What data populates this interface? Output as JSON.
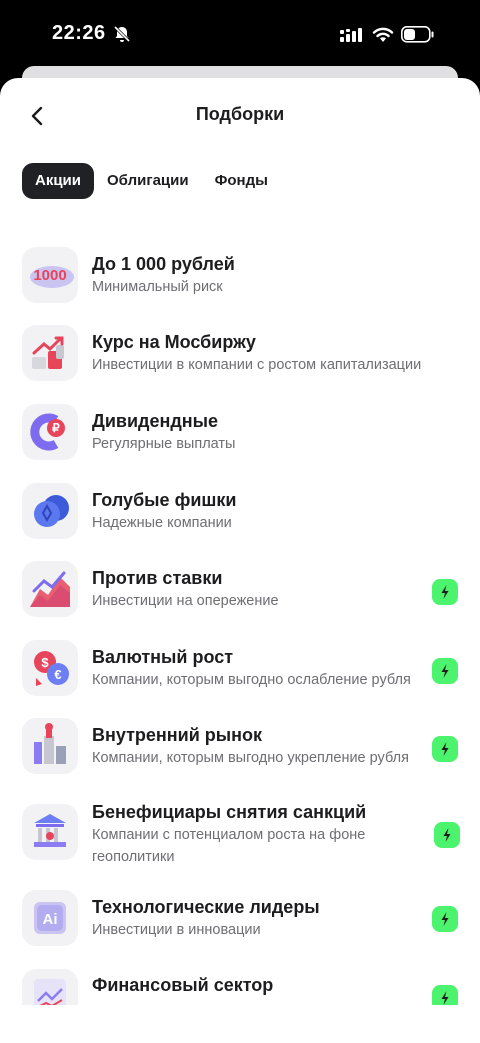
{
  "status_bar": {
    "time": "22:26"
  },
  "header": {
    "title": "Подборки"
  },
  "tabs": [
    {
      "label": "Акции",
      "active": true
    },
    {
      "label": "Облигации",
      "active": false
    },
    {
      "label": "Фонды",
      "active": false
    }
  ],
  "items": [
    {
      "name": "До 1 000 рублей",
      "description": "Минимальный риск",
      "icon": "1000-rubles-icon",
      "premium": false
    },
    {
      "name": "Курс на Мосбиржу",
      "description": "Инвестиции в компании с ростом капитализации",
      "icon": "growth-chart-icon",
      "premium": false
    },
    {
      "name": "Дивидендные",
      "description": "Регулярные выплаты",
      "icon": "ruble-magnet-icon",
      "premium": false
    },
    {
      "name": "Голубые фишки",
      "description": "Надежные компании",
      "icon": "blue-chips-icon",
      "premium": false
    },
    {
      "name": "Против ставки",
      "description": "Инвестиции на опережение",
      "icon": "area-chart-icon",
      "premium": true
    },
    {
      "name": "Валютный рост",
      "description": "Компании, которым выгодно ослабление рубля",
      "icon": "currency-coins-icon",
      "premium": true
    },
    {
      "name": "Внутренний рынок",
      "description": "Компании, которым выгодно укрепление рубля",
      "icon": "domestic-market-icon",
      "premium": true
    },
    {
      "name": "Бенефициары снятия санкций",
      "description": "Компании с потенциалом роста на фоне геополитики",
      "icon": "bank-building-icon",
      "premium": true
    },
    {
      "name": "Технологические лидеры",
      "description": "Инвестиции в инновации",
      "icon": "ai-chip-icon",
      "premium": true
    },
    {
      "name": "Финансовый сектор",
      "description": "",
      "icon": "finance-chart-icon",
      "premium": true
    }
  ]
}
